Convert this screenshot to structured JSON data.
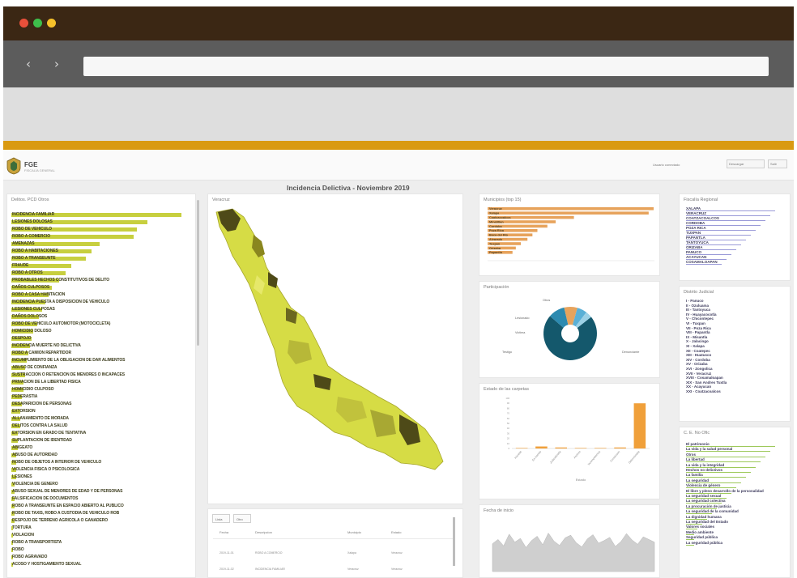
{
  "browser": {
    "dot_colors": [
      "#e8503a",
      "#3ebf4b",
      "#f6c12a"
    ],
    "back_arrow": "‹",
    "forward_arrow": "›"
  },
  "header": {
    "logo_text": "FGE",
    "logo_sub": "FISCALÍA GENERAL",
    "user_label": "Usuario conectado",
    "btn1": "Descargar",
    "btn2": "Salir"
  },
  "dashboard": {
    "title": "Incidencia Delictiva - Noviembre 2019"
  },
  "crimes": {
    "title": "Delitos. PCD Otros",
    "items": [
      {
        "label": "INCIDENCIA FAMILIAR",
        "value": 100
      },
      {
        "label": "LESIONES DOLOSAS",
        "value": 80
      },
      {
        "label": "ROBO DE VEHICULO",
        "value": 74
      },
      {
        "label": "ROBO A COMERCIO",
        "value": 72
      },
      {
        "label": "AMENAZAS",
        "value": 52
      },
      {
        "label": "ROBO A HABITACIONES",
        "value": 47
      },
      {
        "label": "ROBO A TRANSEUNTE",
        "value": 44
      },
      {
        "label": "FRAUDE",
        "value": 35
      },
      {
        "label": "ROBO A OTROS",
        "value": 32
      },
      {
        "label": "PROBABLES HECHOS CONSTITUTIVOS DE DELITO",
        "value": 28
      },
      {
        "label": "DAÑOS CULPOSOS",
        "value": 24
      },
      {
        "label": "ROBO A CASA HABITACION",
        "value": 22
      },
      {
        "label": "INCIDENCIA PUESTA A DISPOSICION DE VEHICULO",
        "value": 20
      },
      {
        "label": "LESIONES CULPOSAS",
        "value": 18
      },
      {
        "label": "DAÑOS DOLOSOS",
        "value": 16
      },
      {
        "label": "ROBO DE VEHICULO AUTOMOTOR (MOTOCICLETA)",
        "value": 15
      },
      {
        "label": "HOMICIDIO DOLOSO",
        "value": 13
      },
      {
        "label": "DESPOJO",
        "value": 12
      },
      {
        "label": "INCIDENCIA MUERTE NO DELICTIVA",
        "value": 11
      },
      {
        "label": "ROBO A CAMION REPARTIDOR",
        "value": 10
      },
      {
        "label": "INCUMPLIMIENTO DE LA OBLIGACION DE DAR ALIMENTOS",
        "value": 9
      },
      {
        "label": "ABUSO DE CONFIANZA",
        "value": 8
      },
      {
        "label": "SUSTRACCION O RETENCION DE MENORES O INCAPACES",
        "value": 8
      },
      {
        "label": "PRIVACION DE LA LIBERTAD FISICA",
        "value": 7
      },
      {
        "label": "HOMICIDIO CULPOSO",
        "value": 7
      },
      {
        "label": "PEDERASTIA",
        "value": 6
      },
      {
        "label": "DESAPARICION DE PERSONAS",
        "value": 6
      },
      {
        "label": "EXTORSION",
        "value": 5
      },
      {
        "label": "ALLANAMIENTO DE MORADA",
        "value": 5
      },
      {
        "label": "DELITOS CONTRA LA SALUD",
        "value": 5
      },
      {
        "label": "EXTORSION EN GRADO DE TENTATIVA",
        "value": 4
      },
      {
        "label": "SUPLANTACION DE IDENTIDAD",
        "value": 4
      },
      {
        "label": "ABIGEATO",
        "value": 4
      },
      {
        "label": "ABUSO DE AUTORIDAD",
        "value": 3
      },
      {
        "label": "ROBO DE OBJETOS A INTERIOR DE VEHICULO",
        "value": 3
      },
      {
        "label": "VIOLENCIA FISICA O PSICOLOGICA",
        "value": 3
      },
      {
        "label": "LESIONES",
        "value": 3
      },
      {
        "label": "VIOLENCIA DE GENERO",
        "value": 2
      },
      {
        "label": "ABUSO SEXUAL DE MENORES DE EDAD Y DE PERSONAS",
        "value": 2
      },
      {
        "label": "FALSIFICACION DE DOCUMENTOS",
        "value": 2
      },
      {
        "label": "ROBO A TRANSEUNTE EN ESPACIO ABIERTO AL PUBLICO",
        "value": 2
      },
      {
        "label": "ROBO DE TAXIS, ROBO A CUSTODIA DE VEHICULO ROB",
        "value": 2
      },
      {
        "label": "DESPOJO DE TERRENO AGRICOLA O GANADERO",
        "value": 2
      },
      {
        "label": "TORTURA",
        "value": 1
      },
      {
        "label": "VIOLACION",
        "value": 1
      },
      {
        "label": "ROBO A TRANSPORTISTA",
        "value": 1
      },
      {
        "label": "ROBO",
        "value": 1
      },
      {
        "label": "ROBO AGRAVADO",
        "value": 1
      },
      {
        "label": "ACOSO Y HOSTIGAMIENTO SEXUAL",
        "value": 1
      }
    ]
  },
  "map": {
    "title": "Veracruz",
    "colors": [
      "#dbe04a",
      "#c6c83b",
      "#a9a835",
      "#4e4a18",
      "#e6e86a"
    ]
  },
  "table": {
    "tabs": [
      "Lista",
      "Otro"
    ],
    "headers": [
      "Fecha",
      "Descripcion",
      "Municipio",
      "Estado"
    ],
    "rows": [
      [
        "2019-11-01",
        "ROBO A COMERCIO",
        "Xalapa",
        "Veracruz"
      ],
      [
        "2019-11-02",
        "INCIDENCIA FAMILIAR",
        "Veracruz",
        "Veracruz"
      ]
    ]
  },
  "municipios": {
    "title": "Municipios (top 15)",
    "bar_color": "#e7a35c",
    "items": [
      {
        "label": "Veracruz",
        "value": 100
      },
      {
        "label": "Xalapa",
        "value": 97
      },
      {
        "label": "Coatzacoalcos",
        "value": 52
      },
      {
        "label": "Minatitlan",
        "value": 41
      },
      {
        "label": "Cordoba",
        "value": 36
      },
      {
        "label": "Poza Rica",
        "value": 30
      },
      {
        "label": "Boca del Rio",
        "value": 27
      },
      {
        "label": "Alvarado",
        "value": 24
      },
      {
        "label": "Tuxpan",
        "value": 20
      },
      {
        "label": "Orizaba",
        "value": 17
      },
      {
        "label": "Papantla",
        "value": 15
      }
    ]
  },
  "participacion": {
    "title": "Participación",
    "slices": [
      {
        "label": "Denunciante",
        "value": 72,
        "color": "#14586c"
      },
      {
        "label": "Otros",
        "value": 10,
        "color": "#2c8ab0"
      },
      {
        "label": "Lesionado",
        "value": 8,
        "color": "#e7a35c"
      },
      {
        "label": "Victima",
        "value": 6,
        "color": "#5ab0d6"
      },
      {
        "label": "Testigo",
        "value": 4,
        "color": "#9cd1e6"
      }
    ],
    "labels": [
      "Otros",
      "Lesionado",
      "Victima",
      "Denunciante",
      "Testigo"
    ]
  },
  "estado": {
    "title": "Estado de las carpetas",
    "xlabel": "Estado",
    "categories": [
      "Iniciada",
      "En tramite",
      "Judicializada",
      "Archivo",
      "Incompetencia",
      "Conclusion",
      "Determinada"
    ],
    "values": [
      1,
      4,
      2,
      1,
      1,
      2,
      90
    ],
    "color": "#f0a03a",
    "ylim": [
      0,
      100
    ]
  },
  "fecha": {
    "title": "Fecha de inicio",
    "values": [
      52,
      60,
      48,
      70,
      55,
      62,
      45,
      58,
      66,
      50,
      72,
      57,
      49,
      63,
      68,
      54,
      46,
      61,
      69,
      53,
      58,
      64,
      47,
      56,
      71,
      59,
      51,
      65,
      60,
      55
    ],
    "color": "#cfcfcf"
  },
  "fiscalia": {
    "title": "Fiscalía Regional",
    "items": [
      "XALAPA",
      "VERACRUZ",
      "COATZACOALCOS",
      "CORDOBA",
      "POZA RICA",
      "TUXPAN",
      "PAPANTLA",
      "TANTOYUCA",
      "ORIZABA",
      "PANUCO",
      "ACAYUCAN",
      "COSAMALOAPAN"
    ],
    "line_color": "#9a9ad8"
  },
  "distrito": {
    "title": "Distrito Judicial",
    "items": [
      "I - Panuco",
      "II - Ozuluama",
      "III - Tantoyuca",
      "IV - Huayacocotla",
      "V - Chicontepec",
      "VI - Tuxpan",
      "VII - Poza Rica",
      "VIII - Papantla",
      "IX - Misantla",
      "X - Jalacingo",
      "XI - Xalapa",
      "XII - Coatepec",
      "XIII - Huatusco",
      "XIV - Cordoba",
      "XV - Orizaba",
      "XVI - Zongolica",
      "XVII - Veracruz",
      "XVIII - Cosamaloapan",
      "XIX - San Andres Tuxtla",
      "XX - Acayucan",
      "XXI - Coatzacoalcos"
    ]
  },
  "bien": {
    "title": "C. E. No Ofic",
    "line_color": "#9dc95a",
    "items": [
      "El patrimonio",
      "La vida y la salud personal",
      "Otros",
      "La libertad",
      "La vida y la integridad",
      "Hechos no delictivos",
      "La familia",
      "La seguridad",
      "Violencia de género",
      "El libre y pleno desarrollo de la personalidad",
      "La seguridad sexual",
      "La seguridad colectiva",
      "La procuración de justicia",
      "La seguridad de la comunidad",
      "La dignidad humana",
      "La seguridad del Estado",
      "Valores sociales",
      "Medio ambiente",
      "Seguridad pública",
      "La seguridad pública"
    ]
  }
}
